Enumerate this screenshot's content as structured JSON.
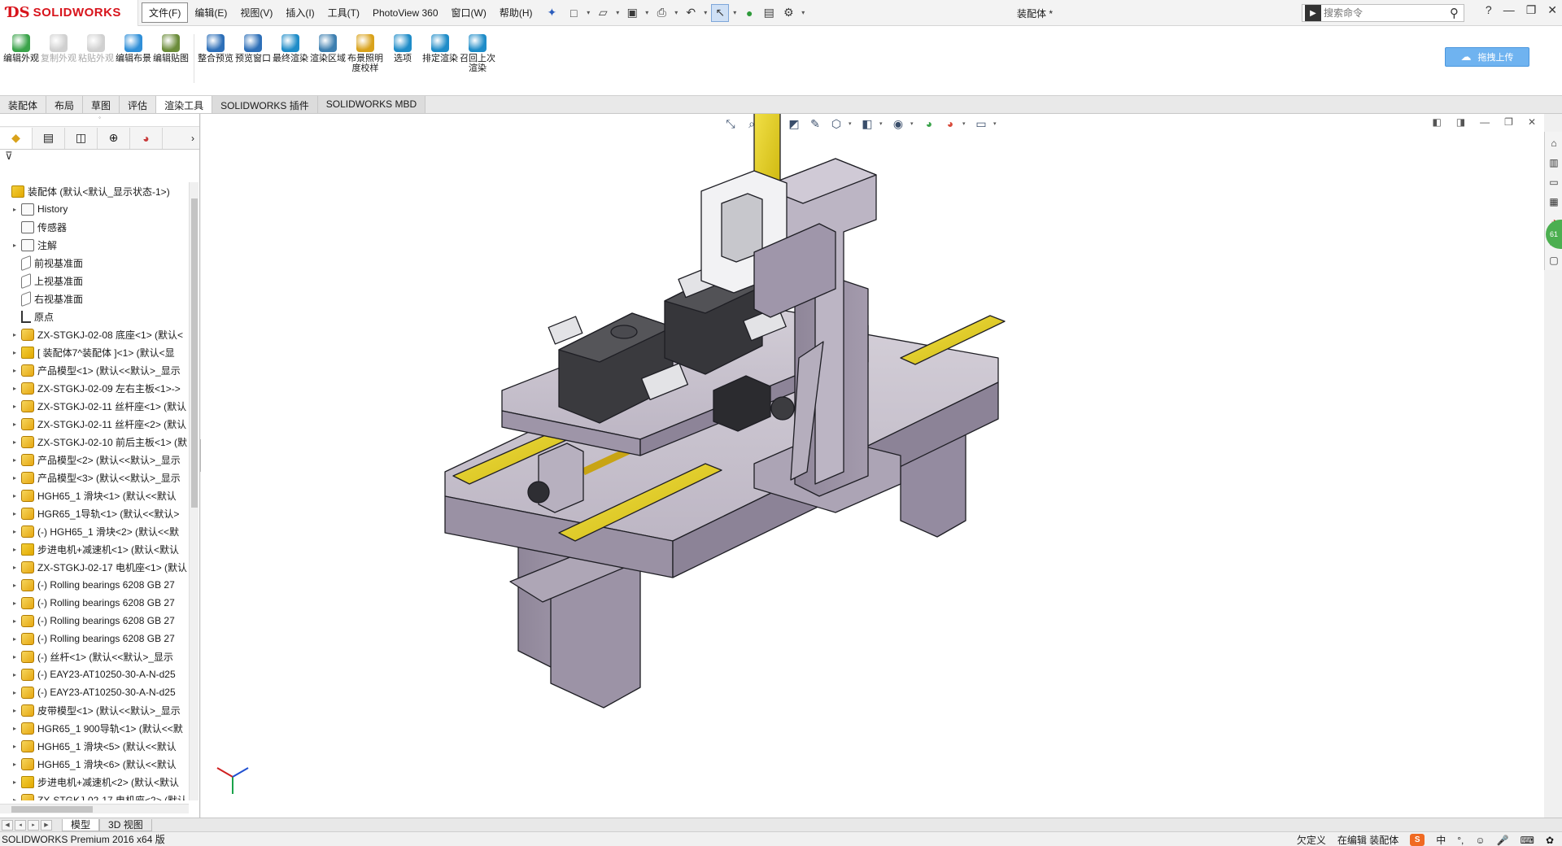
{
  "app": {
    "brand": "SOLIDWORKS",
    "document_title": "装配体 *",
    "menus": [
      "文件(F)",
      "编辑(E)",
      "视图(V)",
      "插入(I)",
      "工具(T)",
      "PhotoView 360",
      "窗口(W)",
      "帮助(H)"
    ],
    "search_placeholder": "搜索命令",
    "help_label": "?"
  },
  "ribbon": {
    "buttons": [
      {
        "label": "编辑外观",
        "color": "#3aa34a",
        "enabled": true
      },
      {
        "label": "复制外观",
        "color": "#7a7a7a",
        "enabled": false
      },
      {
        "label": "粘贴外观",
        "color": "#7a7a7a",
        "enabled": false
      },
      {
        "label": "编辑布景",
        "color": "#2f8fd8",
        "enabled": true
      },
      {
        "label": "编辑贴图",
        "color": "#6b8c3a",
        "enabled": true
      },
      {
        "label": "整合预览",
        "color": "#2d6fb8",
        "enabled": true
      },
      {
        "label": "预览窗口",
        "color": "#2d6fb8",
        "enabled": true
      },
      {
        "label": "最终渲染",
        "color": "#1e8cc8",
        "enabled": true
      },
      {
        "label": "渲染区域",
        "color": "#3d7fb0",
        "enabled": true
      },
      {
        "label": "布景照明度校样",
        "color": "#d9a21b",
        "enabled": true
      },
      {
        "label": "选项",
        "color": "#1e8cc8",
        "enabled": true
      },
      {
        "label": "排定渲染",
        "color": "#1e8cc8",
        "enabled": true
      },
      {
        "label": "召回上次渲染",
        "color": "#1e8cc8",
        "enabled": true
      }
    ],
    "upload_label": "拖拽上传"
  },
  "tabs": [
    "装配体",
    "布局",
    "草图",
    "评估",
    "渲染工具",
    "SOLIDWORKS 插件",
    "SOLIDWORKS MBD"
  ],
  "active_tab": "渲染工具",
  "tree": {
    "items": [
      {
        "label": "装配体 (默认<默认_显示状态-1>)",
        "icon": "asm",
        "indent": 0,
        "caret": false
      },
      {
        "label": "History",
        "icon": "folder",
        "indent": 1,
        "caret": true
      },
      {
        "label": "传感器",
        "icon": "folder",
        "indent": 1,
        "caret": false
      },
      {
        "label": "注解",
        "icon": "folder",
        "indent": 1,
        "caret": true
      },
      {
        "label": "前视基准面",
        "icon": "plane",
        "indent": 1,
        "caret": false
      },
      {
        "label": "上视基准面",
        "icon": "plane",
        "indent": 1,
        "caret": false
      },
      {
        "label": "右视基准面",
        "icon": "plane",
        "indent": 1,
        "caret": false
      },
      {
        "label": "原点",
        "icon": "origin",
        "indent": 1,
        "caret": false
      },
      {
        "label": "ZX-STGKJ-02-08 底座<1> (默认<",
        "icon": "part",
        "indent": 1,
        "caret": true
      },
      {
        "label": "[ 装配体7^装配体 ]<1> (默认<显",
        "icon": "asm",
        "indent": 1,
        "caret": true
      },
      {
        "label": "产品模型<1> (默认<<默认>_显示",
        "icon": "part",
        "indent": 1,
        "caret": true
      },
      {
        "label": "ZX-STGKJ-02-09 左右主板<1>->",
        "icon": "part",
        "indent": 1,
        "caret": true
      },
      {
        "label": "ZX-STGKJ-02-11 丝杆座<1> (默认",
        "icon": "part",
        "indent": 1,
        "caret": true
      },
      {
        "label": "ZX-STGKJ-02-11 丝杆座<2> (默认",
        "icon": "part",
        "indent": 1,
        "caret": true
      },
      {
        "label": "ZX-STGKJ-02-10 前后主板<1> (默",
        "icon": "part",
        "indent": 1,
        "caret": true
      },
      {
        "label": "产品模型<2> (默认<<默认>_显示",
        "icon": "part",
        "indent": 1,
        "caret": true
      },
      {
        "label": "产品模型<3> (默认<<默认>_显示",
        "icon": "part",
        "indent": 1,
        "caret": true
      },
      {
        "label": "HGH65_1 滑块<1> (默认<<默认",
        "icon": "part",
        "indent": 1,
        "caret": true
      },
      {
        "label": "HGR65_1导轨<1> (默认<<默认>",
        "icon": "part",
        "indent": 1,
        "caret": true
      },
      {
        "label": "(-) HGH65_1 滑块<2> (默认<<默",
        "icon": "part",
        "indent": 1,
        "caret": true
      },
      {
        "label": "步进电机+减速机<1> (默认<默认",
        "icon": "asm",
        "indent": 1,
        "caret": true
      },
      {
        "label": "ZX-STGKJ-02-17 电机座<1> (默认",
        "icon": "part",
        "indent": 1,
        "caret": true
      },
      {
        "label": "(-) Rolling bearings 6208 GB 27",
        "icon": "part",
        "indent": 1,
        "caret": true
      },
      {
        "label": "(-) Rolling bearings 6208 GB 27",
        "icon": "part",
        "indent": 1,
        "caret": true
      },
      {
        "label": "(-) Rolling bearings 6208 GB 27",
        "icon": "part",
        "indent": 1,
        "caret": true
      },
      {
        "label": "(-) Rolling bearings 6208 GB 27",
        "icon": "part",
        "indent": 1,
        "caret": true
      },
      {
        "label": "(-) 丝杆<1> (默认<<默认>_显示",
        "icon": "part",
        "indent": 1,
        "caret": true
      },
      {
        "label": "(-) EAY23-AT10250-30-A-N-d25",
        "icon": "part",
        "indent": 1,
        "caret": true
      },
      {
        "label": "(-) EAY23-AT10250-30-A-N-d25",
        "icon": "part",
        "indent": 1,
        "caret": true
      },
      {
        "label": "皮带模型<1> (默认<<默认>_显示",
        "icon": "part",
        "indent": 1,
        "caret": true
      },
      {
        "label": "HGR65_1 900导轨<1> (默认<<默",
        "icon": "part",
        "indent": 1,
        "caret": true
      },
      {
        "label": "HGH65_1 滑块<5> (默认<<默认",
        "icon": "part",
        "indent": 1,
        "caret": true
      },
      {
        "label": "HGH65_1 滑块<6> (默认<<默认",
        "icon": "part",
        "indent": 1,
        "caret": true
      },
      {
        "label": "步进电机+减速机<2> (默认<默认",
        "icon": "asm",
        "indent": 1,
        "caret": true
      },
      {
        "label": "ZX-STGKJ-02-17 电机座<2> (默认",
        "icon": "part",
        "indent": 1,
        "caret": true
      }
    ]
  },
  "bottom_tabs": [
    "模型",
    "3D 视图"
  ],
  "active_bottom_tab": "模型",
  "status": {
    "left": "SOLIDWORKS Premium 2016 x64 版",
    "underdefined": "欠定义",
    "editing": "在编辑 装配体",
    "ime_label": "S",
    "lang": "中"
  },
  "taskpane": {
    "badge": "61"
  },
  "colors": {
    "accent": "#d8141c",
    "model_body": "#a69daf",
    "rail": "#e7d21c",
    "dark_part": "#3a3a3e"
  }
}
